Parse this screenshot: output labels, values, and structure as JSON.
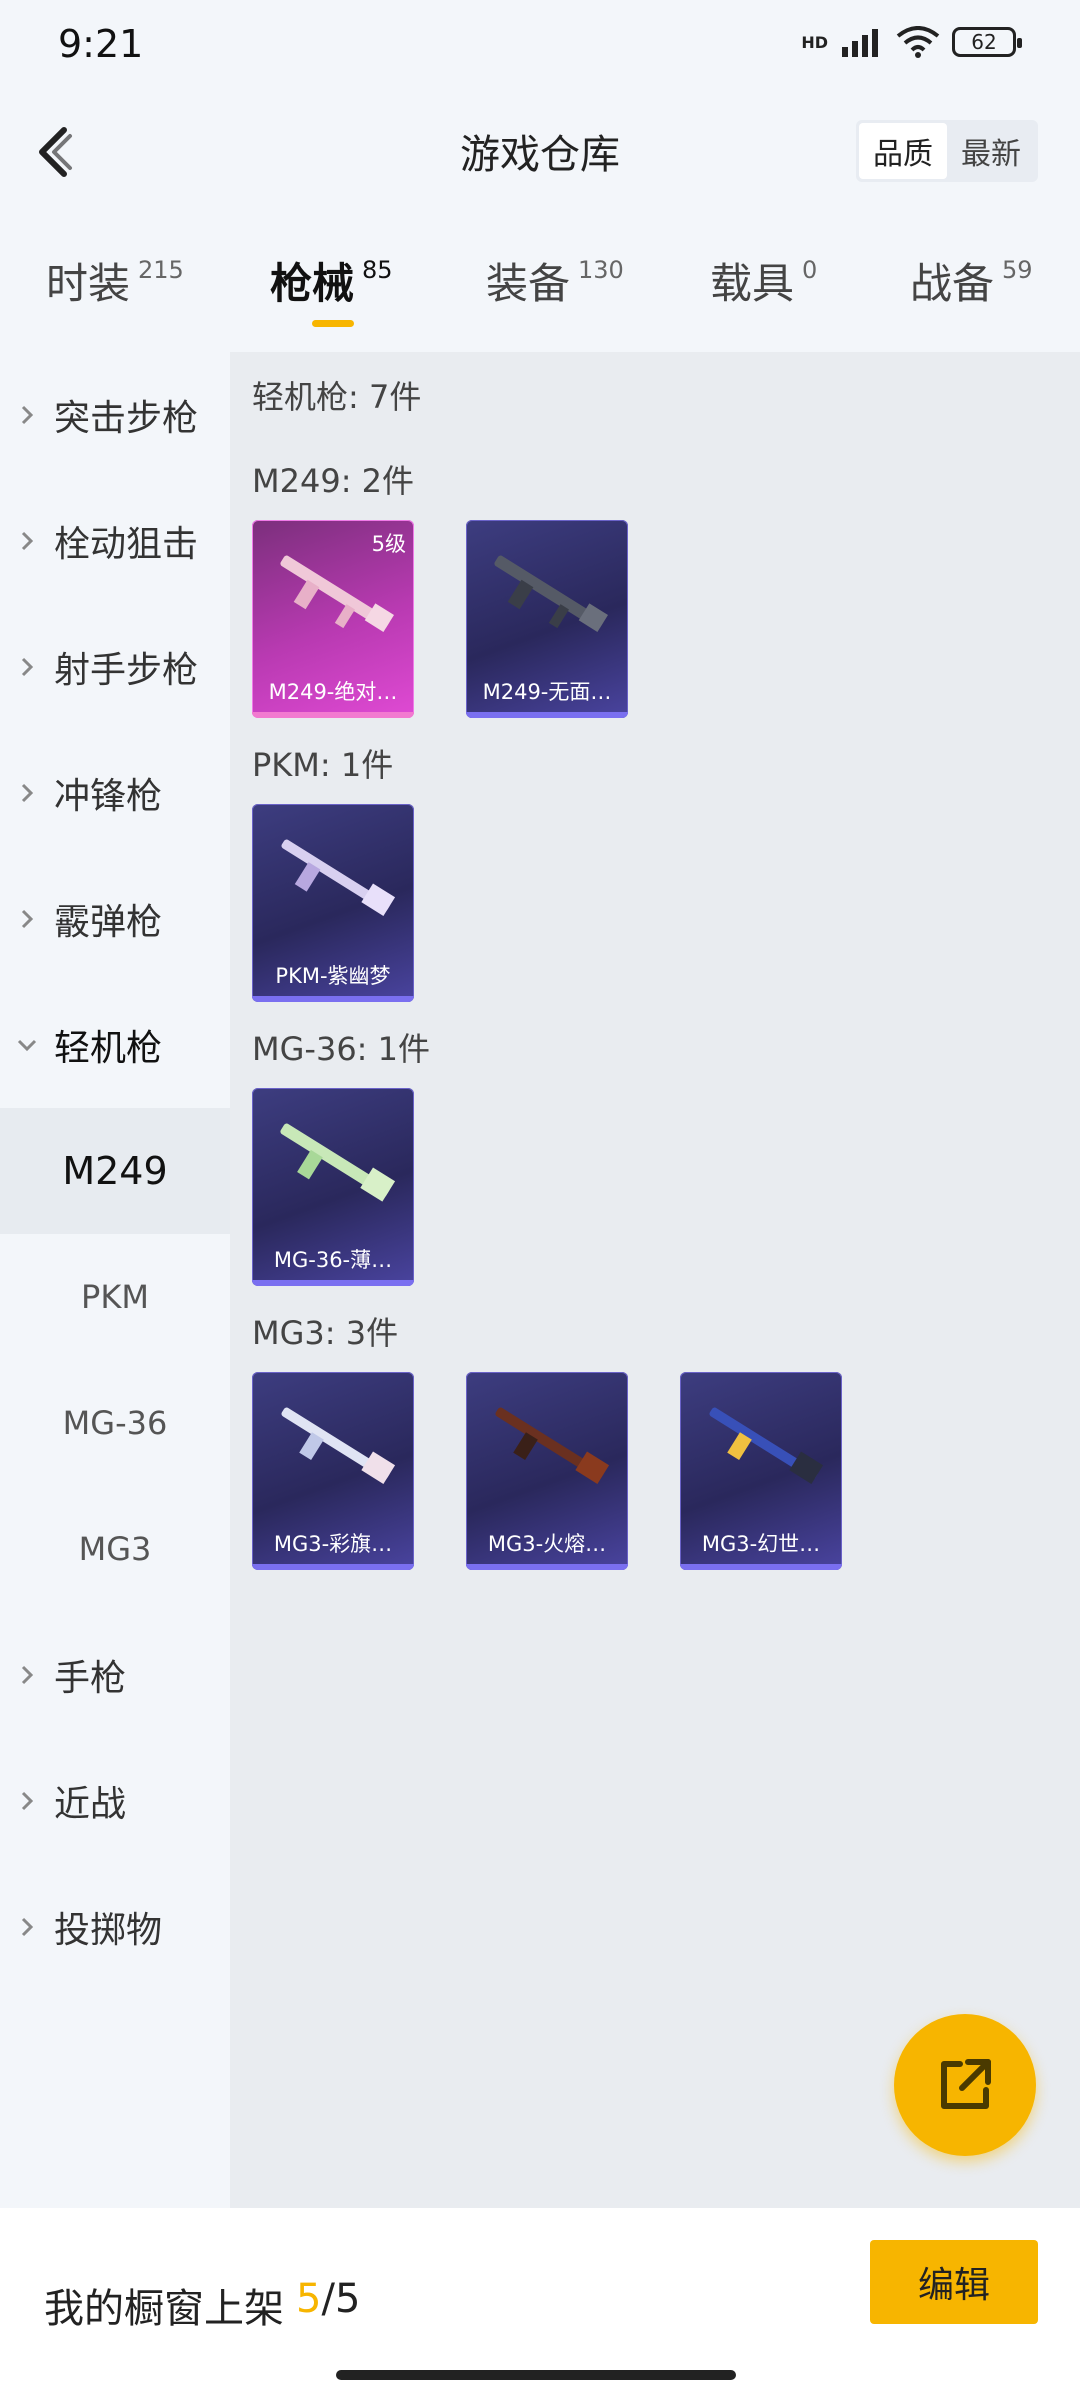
{
  "status_bar": {
    "time": "9:21",
    "battery": "62",
    "network": "HD"
  },
  "header": {
    "title": "游戏仓库",
    "sort_options": [
      "品质",
      "最新"
    ],
    "sort_active": "品质"
  },
  "tabs": [
    {
      "label": "时装",
      "count": "215"
    },
    {
      "label": "枪械",
      "count": "85",
      "active": true
    },
    {
      "label": "装备",
      "count": "130"
    },
    {
      "label": "载具",
      "count": "0"
    },
    {
      "label": "战备",
      "count": "59"
    }
  ],
  "sidebar": {
    "categories_top": [
      "突击步枪",
      "栓动狙击",
      "射手步枪",
      "冲锋枪",
      "霰弹枪"
    ],
    "open_category": "轻机枪",
    "sub_items": [
      "M249",
      "PKM",
      "MG-36",
      "MG3"
    ],
    "active_sub": "M249",
    "categories_bottom": [
      "手枪",
      "近战",
      "投掷物"
    ]
  },
  "content": {
    "section_title": "轻机枪: 7件",
    "groups": [
      {
        "title": "M249: 2件",
        "items": [
          {
            "name": "M249-绝对…",
            "level": "5级",
            "quality": "pink"
          },
          {
            "name": "M249-无面…",
            "quality": "purple"
          }
        ]
      },
      {
        "title": "PKM: 1件",
        "items": [
          {
            "name": "PKM-紫幽梦",
            "quality": "purple"
          }
        ]
      },
      {
        "title": "MG-36: 1件",
        "items": [
          {
            "name": "MG-36-薄…",
            "quality": "purple"
          }
        ]
      },
      {
        "title": "MG3: 3件",
        "items": [
          {
            "name": "MG3-彩旗…",
            "quality": "purple"
          },
          {
            "name": "MG3-火熔…",
            "quality": "purple"
          },
          {
            "name": "MG3-幻世…",
            "quality": "purple"
          }
        ]
      }
    ]
  },
  "bottom_bar": {
    "showcase_label": "我的橱窗上架",
    "showcase_current": "5",
    "showcase_sep": "/",
    "showcase_total": "5",
    "edit_label": "编辑"
  },
  "colors": {
    "accent": "#f7b500",
    "card_purple": "#3d3d80",
    "card_pink": "#b93ab2"
  },
  "icons": [
    "back-arrow-icon",
    "chevron-right-icon",
    "chevron-down-icon",
    "share-icon",
    "signal-icon",
    "wifi-icon",
    "battery-icon"
  ]
}
